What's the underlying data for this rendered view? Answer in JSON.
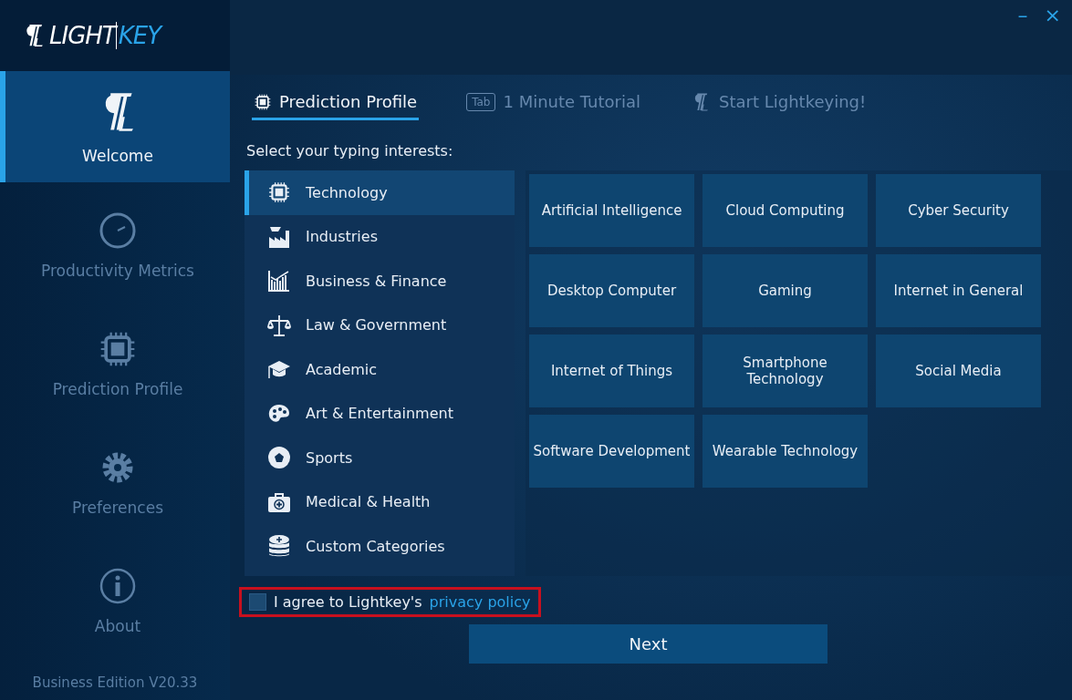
{
  "logo": {
    "text": "LIGHT",
    "accent": "KEY"
  },
  "sidebar": {
    "items": [
      {
        "label": "Welcome",
        "selected": true
      },
      {
        "label": "Productivity Metrics",
        "selected": false
      },
      {
        "label": "Prediction Profile",
        "selected": false
      },
      {
        "label": "Preferences",
        "selected": false
      },
      {
        "label": "About",
        "selected": false
      }
    ],
    "version": "Business Edition V20.33"
  },
  "window_controls": [
    "–",
    "×"
  ],
  "steps": [
    {
      "label": "Prediction Profile",
      "selected": true
    },
    {
      "key": "Tab",
      "label": "1 Minute Tutorial",
      "selected": false
    },
    {
      "label": "Start Lightkeying!",
      "selected": false
    }
  ],
  "prompt": "Select your typing interests:",
  "categories": [
    {
      "label": "Technology",
      "selected": true
    },
    {
      "label": "Industries",
      "selected": false
    },
    {
      "label": "Business & Finance",
      "selected": false
    },
    {
      "label": "Law & Government",
      "selected": false
    },
    {
      "label": "Academic",
      "selected": false
    },
    {
      "label": "Art & Entertainment",
      "selected": false
    },
    {
      "label": "Sports",
      "selected": false
    },
    {
      "label": "Medical & Health",
      "selected": false
    },
    {
      "label": "Custom Categories",
      "selected": false
    }
  ],
  "interests": [
    "Artificial Intelligence",
    "Cloud Computing",
    "Cyber Security",
    "Desktop Computer",
    "Gaming",
    "Internet in General",
    "Internet of Things",
    "Smartphone Technology",
    "Social Media",
    "Software Development",
    "Wearable Technology"
  ],
  "agreement": {
    "text": "I agree to Lightkey's",
    "link": "privacy policy",
    "checked": false,
    "highlighted": true
  },
  "next_button": "Next"
}
